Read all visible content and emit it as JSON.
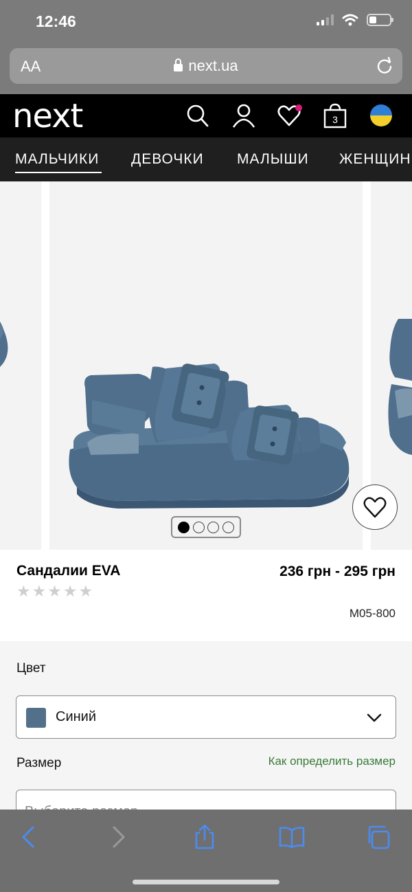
{
  "status_bar": {
    "time": "12:46"
  },
  "browser": {
    "text_size_button": "AA",
    "url": "next.ua"
  },
  "site": {
    "logo": "next",
    "cart_count": "3"
  },
  "categories": [
    "МАЛЬЧИКИ",
    "ДЕВОЧКИ",
    "МАЛЫШИ",
    "ЖЕНЩИНЫ"
  ],
  "gallery": {
    "image_count": 4,
    "active_index": 0
  },
  "product": {
    "title": "Сандалии EVA",
    "rating": 0,
    "price": "236 грн - 295 грн",
    "sku": "M05-800"
  },
  "options": {
    "color_label": "Цвет",
    "color_value": "Синий",
    "color_swatch": "#527089",
    "size_label": "Размер",
    "size_guide_link": "Как определить размер",
    "size_placeholder": "Выберите размер"
  },
  "colors": {
    "accent_pink": "#d81b74",
    "link_green": "#3a7a3a",
    "product_blue": "#4f6f8d"
  }
}
